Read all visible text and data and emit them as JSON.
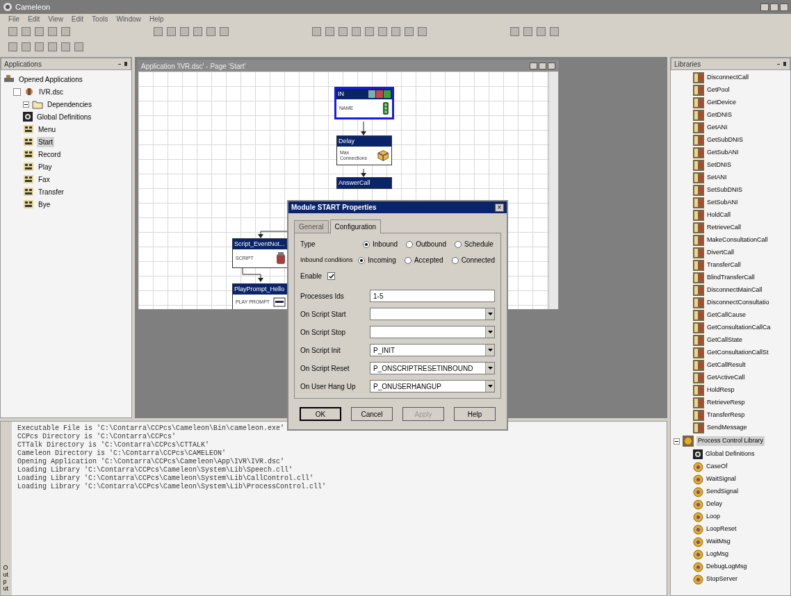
{
  "window": {
    "title": "Cameleon"
  },
  "menu": [
    "File",
    "Edit",
    "View",
    "Edit",
    "Tools",
    "Window",
    "Help"
  ],
  "applications_panel": {
    "title": "Applications",
    "tree": [
      {
        "label": "Opened Applications",
        "kind": "root",
        "selected": false,
        "children": [
          {
            "label": "IVR.dsc",
            "kind": "app",
            "selected": false,
            "checked": false,
            "children": [
              {
                "label": "Dependencies",
                "kind": "folder",
                "selected": false
              },
              {
                "label": "Global Definitions",
                "kind": "global",
                "selected": false
              },
              {
                "label": "Menu",
                "kind": "page",
                "selected": false
              },
              {
                "label": "Start",
                "kind": "page",
                "selected": true
              },
              {
                "label": "Record",
                "kind": "page",
                "selected": false
              },
              {
                "label": "Play",
                "kind": "page",
                "selected": false
              },
              {
                "label": "Fax",
                "kind": "page",
                "selected": false
              },
              {
                "label": "Transfer",
                "kind": "page",
                "selected": false
              },
              {
                "label": "Bye",
                "kind": "page",
                "selected": false
              }
            ]
          }
        ]
      }
    ]
  },
  "canvas_window": {
    "title": "Application 'IVR.dsc' - Page 'Start'",
    "nodes": [
      {
        "title": "IN",
        "text": "NAME",
        "kind": "start",
        "selected": true
      },
      {
        "title": "Delay",
        "text": "Max Connections",
        "kind": "delay",
        "selected": false
      },
      {
        "title": "AnswerCall",
        "kind": "plain",
        "selected": false
      },
      {
        "title": "Script_EventNot...",
        "text": "SCRIPT",
        "kind": "script",
        "selected": false
      },
      {
        "title": "PlayPrompt_Hello",
        "text": "PLAY PROMPT",
        "kind": "prompt",
        "selected": false
      }
    ]
  },
  "dialog": {
    "title": "Module START Properties",
    "close": "×",
    "tabs": [
      {
        "label": "General",
        "selected": false
      },
      {
        "label": "Configuration",
        "selected": true
      }
    ],
    "type": {
      "label": "Type",
      "options": [
        {
          "label": "Inbound",
          "selected": true
        },
        {
          "label": "Outbound",
          "selected": false
        },
        {
          "label": "Schedule",
          "selected": false
        }
      ]
    },
    "inbound_conditions": {
      "label": "Inbound conditions",
      "options": [
        {
          "label": "Incoming",
          "selected": true
        },
        {
          "label": "Accepted",
          "selected": false
        },
        {
          "label": "Connected",
          "selected": false
        }
      ]
    },
    "enable": {
      "label": "Enable",
      "checked": true
    },
    "processes_ids": {
      "label": "Processes Ids",
      "value": "1-5"
    },
    "dropdowns": [
      {
        "label": "On Script Start"
      },
      {
        "label": "On Script Stop"
      },
      {
        "label": "On Script Init",
        "value": "P_INIT"
      },
      {
        "label": "On Script Reset",
        "value": "P_ONSCRIPTRESETINBOUND"
      },
      {
        "label": "On User Hang Up",
        "value": "P_ONUSERHANGUP"
      }
    ],
    "buttons": [
      {
        "label": "OK",
        "disabled": false
      },
      {
        "label": "Cancel",
        "disabled": false
      },
      {
        "label": "Apply",
        "disabled": true
      },
      {
        "label": "Help",
        "disabled": false
      }
    ]
  },
  "libraries_panel": {
    "title": "Libraries",
    "items": [
      {
        "label": "DisconnectCall",
        "kind": "call"
      },
      {
        "label": "GetPool",
        "kind": "call"
      },
      {
        "label": "GetDevice",
        "kind": "call"
      },
      {
        "label": "GetDNIS",
        "kind": "call"
      },
      {
        "label": "GetANI",
        "kind": "call"
      },
      {
        "label": "GetSubDNIS",
        "kind": "call"
      },
      {
        "label": "GetSubANI",
        "kind": "call"
      },
      {
        "label": "SetDNIS",
        "kind": "call"
      },
      {
        "label": "SetANI",
        "kind": "call"
      },
      {
        "label": "SetSubDNIS",
        "kind": "call"
      },
      {
        "label": "SetSubANI",
        "kind": "call"
      },
      {
        "label": "HoldCall",
        "kind": "call"
      },
      {
        "label": "RetrieveCall",
        "kind": "call"
      },
      {
        "label": "MakeConsultationCall",
        "kind": "call"
      },
      {
        "label": "DivertCall",
        "kind": "call"
      },
      {
        "label": "TransferCall",
        "kind": "call"
      },
      {
        "label": "BlindTransferCall",
        "kind": "call"
      },
      {
        "label": "DisconnectMainCall",
        "kind": "call"
      },
      {
        "label": "DisconnectConsultatio",
        "kind": "call"
      },
      {
        "label": "GetCallCause",
        "kind": "call"
      },
      {
        "label": "GetConsultationCallCa",
        "kind": "call"
      },
      {
        "label": "GetCallState",
        "kind": "call"
      },
      {
        "label": "GetConsultationCallSt",
        "kind": "call"
      },
      {
        "label": "GetCallResult",
        "kind": "call"
      },
      {
        "label": "GetActiveCall",
        "kind": "call"
      },
      {
        "label": "HoldResp",
        "kind": "call"
      },
      {
        "label": "RetrieveResp",
        "kind": "call"
      },
      {
        "label": "TransferResp",
        "kind": "call"
      },
      {
        "label": "SendMessage",
        "kind": "call"
      }
    ],
    "library": {
      "label": "Process Control Library",
      "selected": true,
      "expanded": true,
      "items": [
        {
          "label": "Global Definitions",
          "kind": "global"
        },
        {
          "label": "CaseOf",
          "kind": "process"
        },
        {
          "label": "WaitSignal",
          "kind": "process"
        },
        {
          "label": "SendSignal",
          "kind": "process"
        },
        {
          "label": "Delay",
          "kind": "process"
        },
        {
          "label": "Loop",
          "kind": "process"
        },
        {
          "label": "LoopReset",
          "kind": "process"
        },
        {
          "label": "WaitMsg",
          "kind": "process"
        },
        {
          "label": "LogMsg",
          "kind": "process"
        },
        {
          "label": "DebugLogMsg",
          "kind": "process"
        },
        {
          "label": "StopServer",
          "kind": "process"
        }
      ]
    }
  },
  "output": {
    "label": "Output",
    "lines": [
      "Executable File is 'C:\\Contarra\\CCPcs\\Cameleon\\Bin\\cameleon.exe'",
      "CCPcs Directory is 'C:\\Contarra\\CCPcs'",
      "CTTalk Directory is 'C:\\Contarra\\CCPcs\\CTTALK'",
      "Cameleon Directory is 'C:\\Contarra\\CCPcs\\CAMELEON'",
      "Opening Application 'C:\\Contarra\\CCPcs\\Cameleon\\App\\IVR\\IVR.dsc'",
      "Loading Library 'C:\\Contarra\\CCPcs\\Cameleon\\System\\Lib\\Speech.cll'",
      "Loading Library 'C:\\Contarra\\CCPcs\\Cameleon\\System\\Lib\\CallControl.cll'",
      "Loading Library 'C:\\Contarra\\CCPcs\\Cameleon\\System\\Lib\\ProcessControl.cll'"
    ]
  }
}
